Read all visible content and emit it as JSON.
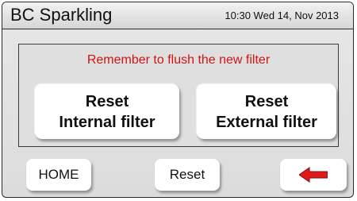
{
  "header": {
    "title": "BC Sparkling",
    "datetime": "10:30 Wed 14, Nov 2013"
  },
  "panel": {
    "notice": "Remember to flush the new filter",
    "reset_internal": {
      "line1": "Reset",
      "line2": "Internal filter"
    },
    "reset_external": {
      "line1": "Reset",
      "line2": "External filter"
    }
  },
  "footer": {
    "home_label": "HOME",
    "reset_label": "Reset",
    "back_icon": "left-arrow-icon"
  },
  "colors": {
    "notice_text": "#d21414",
    "back_arrow": "#e01818"
  }
}
